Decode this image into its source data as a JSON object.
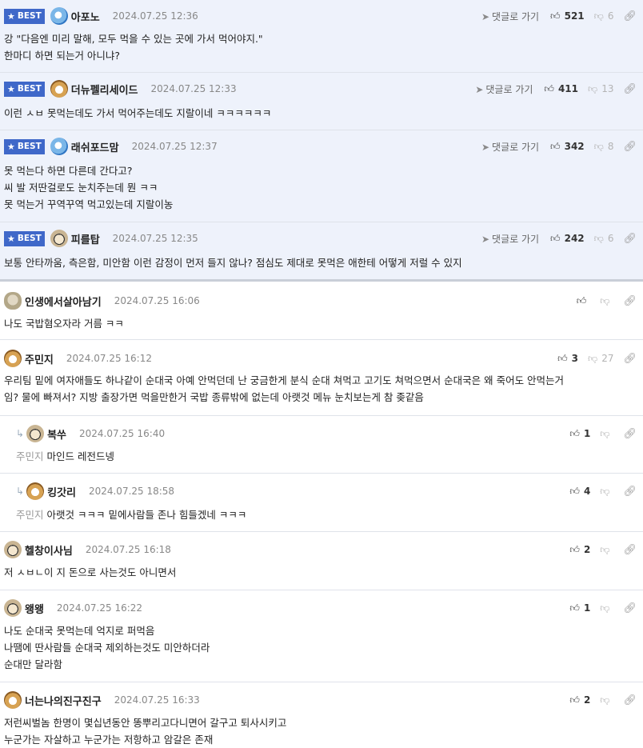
{
  "labels": {
    "best": "BEST",
    "reply_link": "댓글로 가기"
  },
  "best_comments": [
    {
      "nick": "아포노",
      "date": "2024.07.25 12:36",
      "up": "521",
      "down": "6",
      "avatar": "blue-mascot-icon",
      "lines": [
        "강 \"다음엔 미리 말해, 모두 먹을 수 있는 곳에 가서 먹어야지.\"",
        "한마디 하면 되는거 아니냐?"
      ]
    },
    {
      "nick": "더뉴펠리세이드",
      "date": "2024.07.25 12:33",
      "up": "411",
      "down": "13",
      "avatar": "fox-icon",
      "lines": [
        "이런 ㅅㅂ 못먹는데도 가서 먹어주는데도 지랄이네 ㅋㅋㅋㅋㅋㅋ"
      ]
    },
    {
      "nick": "래쉬포드맘",
      "date": "2024.07.25 12:37",
      "up": "342",
      "down": "8",
      "avatar": "blue-mascot-icon",
      "lines": [
        "못 먹는다 하면 다른데 간다고?",
        "씨 발 저딴걸로도 눈치주는데 뭔 ㅋㅋ",
        "못 먹는거 꾸역꾸역 먹고있는데 지랄이농"
      ]
    },
    {
      "nick": "피를탑",
      "date": "2024.07.25 12:35",
      "up": "242",
      "down": "6",
      "avatar": "puppy-icon",
      "lines": [
        "보통 안타까움, 측은함, 미안함 이런 감정이 먼저 들지 않나? 점심도 제대로 못먹은 애한테 어떻게 저럴 수 있지"
      ]
    }
  ],
  "comments": [
    {
      "nick": "인생에서살아남기",
      "date": "2024.07.25 16:06",
      "up": "",
      "down": "",
      "avatar": "rock-icon",
      "lines": [
        "나도 국밥혐오자라 거름 ㅋㅋ"
      ]
    },
    {
      "nick": "주민지",
      "date": "2024.07.25 16:12",
      "up": "3",
      "down": "27",
      "avatar": "fox-icon",
      "lines": [
        "우리팀 밑에 여자애들도 하나같이 순대국 아예 안먹던데 난 궁금한게 분식 순대 쳐먹고 고기도 쳐먹으면서 순대국은 왜 죽어도 안먹는거",
        "임? 물에 빠져서? 지방 출장가면 먹을만한거 국밥 종류밖에 없는데 아랫것 메뉴 눈치보는게 참 좆같음"
      ]
    },
    {
      "nick": "복쑤",
      "date": "2024.07.25 16:40",
      "up": "1",
      "down": "",
      "avatar": "puppy-icon",
      "reply": true,
      "mention": "주민지",
      "lines": [
        "마인드 레전드넹"
      ]
    },
    {
      "nick": "킹갓리",
      "date": "2024.07.25 18:58",
      "up": "4",
      "down": "",
      "avatar": "fox-icon",
      "reply": true,
      "mention": "주민지",
      "lines": [
        "아랫것 ㅋㅋㅋ 밑에사람들 존나 힘들겠네 ㅋㅋㅋ"
      ]
    },
    {
      "nick": "헬창이사님",
      "date": "2024.07.25 16:18",
      "up": "2",
      "down": "",
      "avatar": "puppy-icon",
      "lines": [
        "저 ㅅㅂㄴ이 지 돈으로 사는것도 아니면서"
      ]
    },
    {
      "nick": "왱왱",
      "date": "2024.07.25 16:22",
      "up": "1",
      "down": "",
      "avatar": "puppy-icon",
      "lines": [
        "나도 순대국 못먹는데 억지로 퍼먹음",
        "나땜에 딴사람들 순대국 제외하는것도 미안하더라",
        "순대만 달라함"
      ]
    },
    {
      "nick": "너는나의진구진구",
      "date": "2024.07.25 16:33",
      "up": "2",
      "down": "",
      "avatar": "fox-icon",
      "lines": [
        "저런씨벌놈 한명이 몇십년동안 똥뿌리고다니면어 갈구고 퇴사시키고",
        "누군가는 자살하고 누군가는 저항하고 암갈은 존재"
      ]
    }
  ]
}
